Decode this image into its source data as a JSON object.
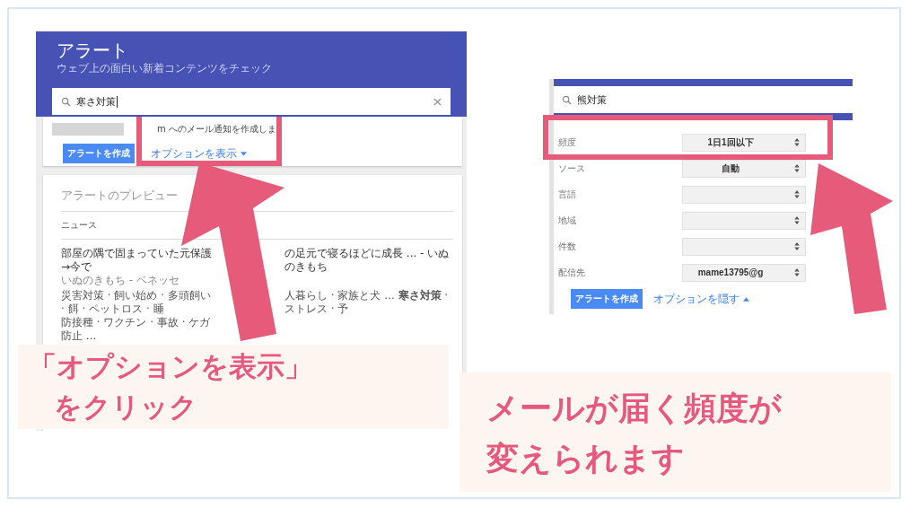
{
  "left_screenshot": {
    "header": {
      "title": "アラート",
      "subtitle": "ウェブ上の面白い新着コンテンツをチェック"
    },
    "search": {
      "value": "寒さ対策"
    },
    "notice": "m へのメール通知を作成しま",
    "create_button": "アラートを作成",
    "options_link": {
      "label": "オプションを表示",
      "expanded": false
    },
    "preview": {
      "title": "アラートのプレビュー",
      "section": "ニュース",
      "headline_parts": [
        "部屋の隅で固まっていた元保護",
        "→今で",
        "の足元で寝るほどに成長 ... - いぬのきもち"
      ],
      "source": "いぬのきもち - ベネッセ",
      "tag_parts": [
        "災害対策 · 飼い始め · 多頭飼い · 餌 · ペットロス · 睡",
        "人暮らし · 家族と犬 ... **寒さ対策** · ストレス · 予",
        "防接種 · ワクチン · 事故 · ケガ防止 ..."
      ]
    }
  },
  "right_screenshot": {
    "search": {
      "value": "熊対策"
    },
    "options": [
      {
        "label": "頻度",
        "value": "1日1回以下"
      },
      {
        "label": "ソース",
        "value": "自動"
      },
      {
        "label": "言語"
      },
      {
        "label": "地域"
      },
      {
        "label": "件数"
      },
      {
        "label": "配信先",
        "value": "mame13795@g"
      }
    ],
    "create_button": "アラートを作成",
    "options_link": {
      "label": "オプションを隠す",
      "expanded": true
    }
  },
  "callouts": [
    {
      "lines": [
        "「オプションを表示」",
        "をクリック"
      ]
    },
    {
      "lines": [
        "メールが届く頻度が",
        "変えられます"
      ]
    }
  ]
}
